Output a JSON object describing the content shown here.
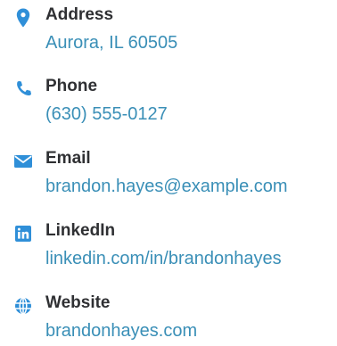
{
  "colors": {
    "icon": "#2f8fd8",
    "title": "#2f3033",
    "value": "#3a8fb7",
    "background": "#ffffff"
  },
  "contacts": [
    {
      "icon": "location-pin-icon",
      "title": "Address",
      "value": "Aurora, IL 60505"
    },
    {
      "icon": "phone-icon",
      "title": "Phone",
      "value": "(630) 555-0127"
    },
    {
      "icon": "envelope-icon",
      "title": "Email",
      "value": "brandon.hayes@example.com"
    },
    {
      "icon": "linkedin-icon",
      "title": "LinkedIn",
      "value": "linkedin.com/in/brandonhayes"
    },
    {
      "icon": "globe-icon",
      "title": "Website",
      "value": "brandonhayes.com"
    }
  ]
}
